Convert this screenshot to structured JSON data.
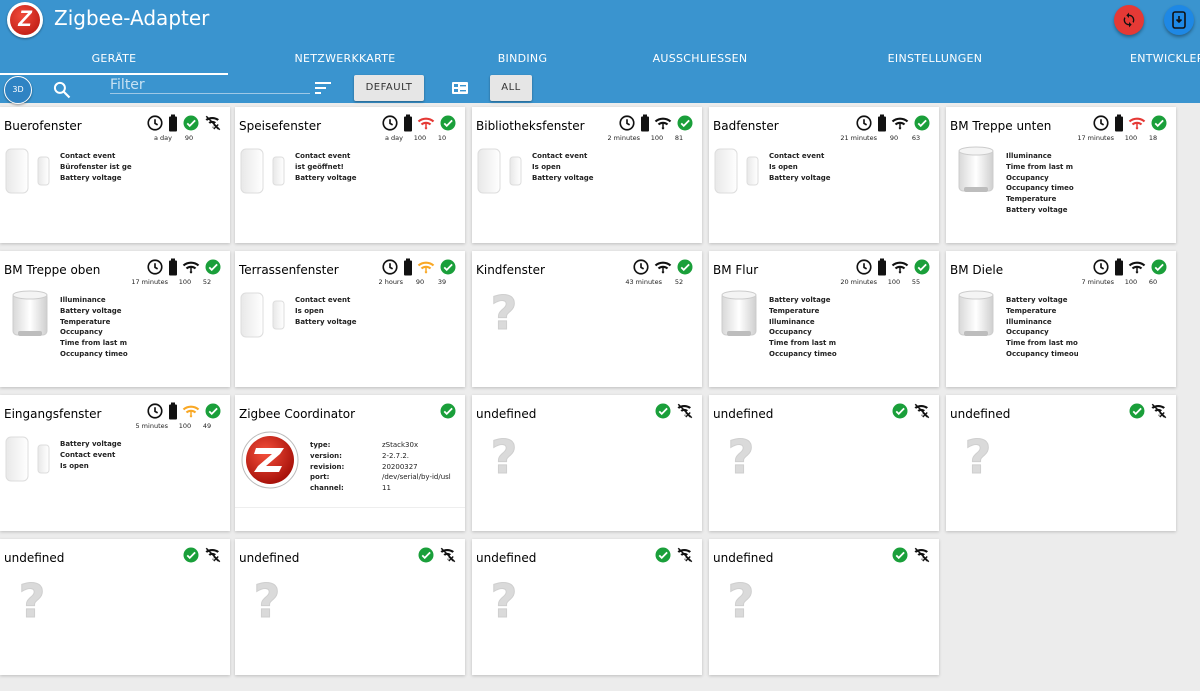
{
  "app": {
    "title": "Zigbee-Adapter"
  },
  "tabs": [
    {
      "label": "GERÄTE"
    },
    {
      "label": "NETZWERKKARTE"
    },
    {
      "label": "BINDING"
    },
    {
      "label": "AUSSCHLIESSEN"
    },
    {
      "label": "EINSTELLUNGEN"
    },
    {
      "label": "ENTWICKLER"
    }
  ],
  "toolbar": {
    "btn_3d": "3D",
    "filter_placeholder": "Filter",
    "default_label": "DEFAULT",
    "all_label": "ALL"
  },
  "colors": {
    "header": "#3a94cf",
    "ok": "#1a9f3a",
    "link_red": "#e53935",
    "link_orange": "#f9a825"
  },
  "devices": [
    {
      "title": "Buerofenster",
      "type": "contact",
      "time": "a day",
      "battery": "90",
      "link": "",
      "link_color": "",
      "status": "ok",
      "unlinked": true,
      "props": [
        "Contact event",
        "Bürofenster ist geö",
        "Battery voltage"
      ]
    },
    {
      "title": "Speisefenster",
      "type": "contact",
      "time": "a day",
      "battery": "100",
      "link": "10",
      "link_color": "red",
      "status": "ok",
      "unlinked": false,
      "props": [
        "Contact event",
        "ist geöffnet!",
        "Battery voltage"
      ]
    },
    {
      "title": "Bibliotheksfenster",
      "type": "contact",
      "time": "2 minutes",
      "battery": "100",
      "link": "81",
      "link_color": "black",
      "status": "ok",
      "unlinked": false,
      "props": [
        "Contact event",
        "Is open",
        "Battery voltage"
      ]
    },
    {
      "title": "Badfenster",
      "type": "contact",
      "time": "21 minutes",
      "battery": "90",
      "link": "63",
      "link_color": "black",
      "status": "ok",
      "unlinked": false,
      "props": [
        "Contact event",
        "Is open",
        "Battery voltage"
      ]
    },
    {
      "title": "BM Treppe unten",
      "type": "motion",
      "time": "17 minutes",
      "battery": "100",
      "link": "18",
      "link_color": "red",
      "status": "ok",
      "unlinked": false,
      "props": [
        "Illuminance",
        "Time from last m",
        "Occupancy",
        "Occupancy timeo",
        "Temperature",
        "Battery voltage"
      ]
    },
    {
      "title": "BM Treppe oben",
      "type": "motion",
      "time": "17 minutes",
      "battery": "100",
      "link": "52",
      "link_color": "black",
      "status": "ok",
      "unlinked": false,
      "props": [
        "Illuminance",
        "Battery voltage",
        "Temperature",
        "Occupancy",
        "Time from last m",
        "Occupancy timeo"
      ]
    },
    {
      "title": "Terrassenfenster",
      "type": "contact",
      "time": "2 hours",
      "battery": "90",
      "link": "39",
      "link_color": "orange",
      "status": "ok",
      "unlinked": false,
      "props": [
        "Contact event",
        "Is open",
        "Battery voltage"
      ]
    },
    {
      "title": "Kindfenster",
      "type": "unknown",
      "time": "43 minutes",
      "battery": "",
      "link": "52",
      "link_color": "black",
      "status": "ok",
      "unlinked": false,
      "props": []
    },
    {
      "title": "BM Flur",
      "type": "motion",
      "time": "20 minutes",
      "battery": "100",
      "link": "55",
      "link_color": "black",
      "status": "ok",
      "unlinked": false,
      "props": [
        "Battery voltage",
        "Temperature",
        "Illuminance",
        "Occupancy",
        "Time from last m",
        "Occupancy timeo"
      ]
    },
    {
      "title": "BM Diele",
      "type": "motion",
      "time": "7 minutes",
      "battery": "100",
      "link": "60",
      "link_color": "black",
      "status": "ok",
      "unlinked": false,
      "props": [
        "Battery voltage",
        "Temperature",
        "Illuminance",
        "Occupancy",
        "Time from last mo",
        "Occupancy timeou"
      ]
    },
    {
      "title": "Eingangsfenster",
      "type": "contact",
      "time": "5 minutes",
      "battery": "100",
      "link": "49",
      "link_color": "orange",
      "status": "ok",
      "unlinked": false,
      "props": [
        "Battery voltage",
        "Contact event",
        "Is open"
      ]
    },
    {
      "title": "Zigbee Coordinator",
      "type": "coordinator",
      "time": "",
      "battery": "",
      "link": "",
      "link_color": "",
      "status": "ok",
      "unlinked": false,
      "props": [],
      "coord": [
        {
          "k": "type:",
          "v": "zStack30x"
        },
        {
          "k": "version:",
          "v": "2-2.7.2."
        },
        {
          "k": "revision:",
          "v": "20200327"
        },
        {
          "k": "port:",
          "v": "/dev/serial/by-id/usl"
        },
        {
          "k": "channel:",
          "v": "11"
        }
      ]
    },
    {
      "title": "undefined",
      "type": "unknown",
      "time": "",
      "battery": "",
      "link": "",
      "link_color": "",
      "status": "ok",
      "unlinked": true,
      "props": []
    },
    {
      "title": "undefined",
      "type": "unknown",
      "time": "",
      "battery": "",
      "link": "",
      "link_color": "",
      "status": "ok",
      "unlinked": true,
      "props": []
    },
    {
      "title": "undefined",
      "type": "unknown",
      "time": "",
      "battery": "",
      "link": "",
      "link_color": "",
      "status": "ok",
      "unlinked": true,
      "props": []
    },
    {
      "title": "undefined",
      "type": "unknown",
      "time": "",
      "battery": "",
      "link": "",
      "link_color": "",
      "status": "ok",
      "unlinked": true,
      "props": []
    },
    {
      "title": "undefined",
      "type": "unknown",
      "time": "",
      "battery": "",
      "link": "",
      "link_color": "",
      "status": "ok",
      "unlinked": true,
      "props": []
    },
    {
      "title": "undefined",
      "type": "unknown",
      "time": "",
      "battery": "",
      "link": "",
      "link_color": "",
      "status": "ok",
      "unlinked": true,
      "props": []
    },
    {
      "title": "undefined",
      "type": "unknown",
      "time": "",
      "battery": "",
      "link": "",
      "link_color": "",
      "status": "ok",
      "unlinked": true,
      "props": []
    }
  ]
}
